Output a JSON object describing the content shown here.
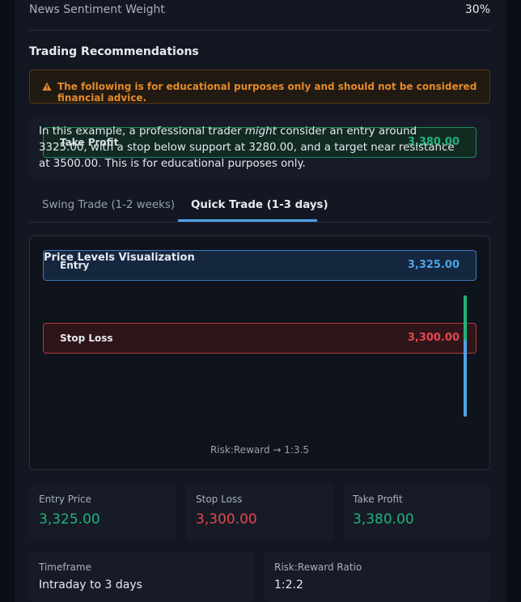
{
  "sentiment": {
    "label": "News Sentiment Weight",
    "value": "30%"
  },
  "section_title": "Trading Recommendations",
  "warning": {
    "icon": "warning-triangle-icon",
    "text": "The following is for educational purposes only and should not be considered financial advice."
  },
  "example": {
    "overlay_label": "Take Profit",
    "overlay_value": "3,380.00",
    "text_before": "In this example, a professional trader ",
    "text_emph": "might",
    "text_after": " consider an entry around 3325.00, with a stop below support at 3280.00, and a target near resistance at 3500.00. This is for educational purposes only."
  },
  "tabs": [
    {
      "label": "Swing Trade (1-2 weeks)",
      "active": false
    },
    {
      "label": "Quick Trade (1-3 days)",
      "active": true
    }
  ],
  "viz": {
    "title": "Price Levels Visualization",
    "entry": {
      "label": "Entry",
      "value": "3,325.00"
    },
    "stop": {
      "label": "Stop Loss",
      "value": "3,300.00"
    },
    "risk_reward": "Risk:Reward → 1:3.5"
  },
  "cards": {
    "entry_price": {
      "label": "Entry Price",
      "value": "3,325.00"
    },
    "stop_loss": {
      "label": "Stop Loss",
      "value": "3,300.00"
    },
    "take_profit": {
      "label": "Take Profit",
      "value": "3,380.00"
    },
    "timeframe": {
      "label": "Timeframe",
      "value": "Intraday to 3 days"
    },
    "risk_reward": {
      "label": "Risk:Reward Ratio",
      "value": "1:2.2"
    }
  },
  "colors": {
    "green": "#21b27a",
    "red": "#e5484d",
    "blue": "#4da3e8",
    "warning": "#e58a2b"
  }
}
